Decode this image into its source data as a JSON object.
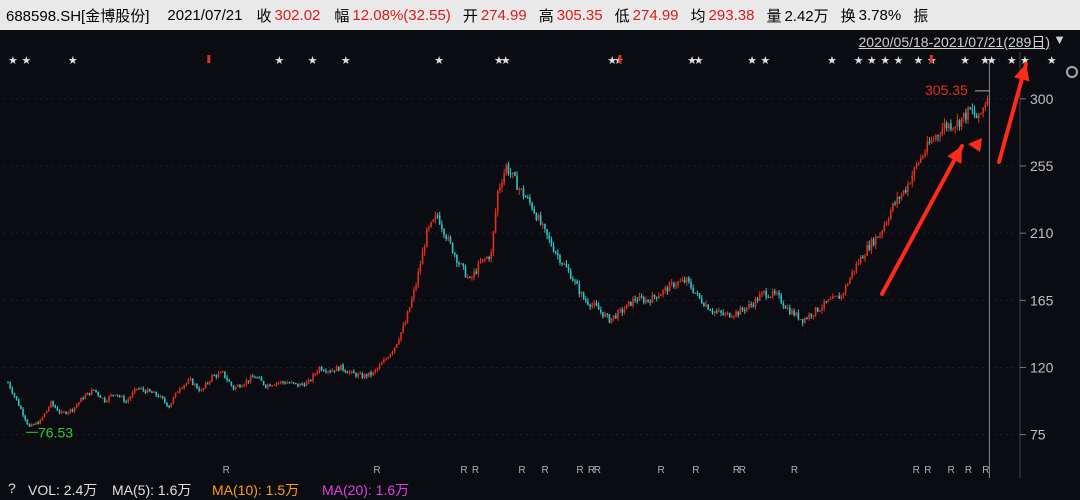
{
  "header": {
    "code": "688598.SH[金博股份]",
    "date": "2021/07/21",
    "close_label": "收",
    "close": "302.02",
    "change_label": "幅",
    "change": "12.08%(32.55)",
    "open_label": "开",
    "open": "274.99",
    "high_label": "高",
    "high": "305.35",
    "low_label": "低",
    "low": "274.99",
    "avg_label": "均",
    "avg": "293.38",
    "volume_label": "量",
    "volume": "2.42万",
    "turnover_label": "换",
    "turnover": "3.78%",
    "amplitude_label": "振"
  },
  "range": {
    "text": "2020/05/18-2021/07/21(289日)",
    "arrow": "▼"
  },
  "chart_data": {
    "type": "candlestick",
    "ylim": [
      60,
      318
    ],
    "yticks": [
      300,
      255,
      210,
      165,
      120,
      75
    ],
    "ytick_labels": [
      "300",
      "255",
      "210",
      "165",
      "120",
      "75"
    ],
    "annotations": {
      "high": "305.35",
      "low": "76.53"
    },
    "close_trend": [
      [
        0,
        110
      ],
      [
        5,
        95
      ],
      [
        10,
        80
      ],
      [
        15,
        84
      ],
      [
        20,
        96
      ],
      [
        25,
        89
      ],
      [
        30,
        92
      ],
      [
        35,
        100
      ],
      [
        40,
        105
      ],
      [
        45,
        98
      ],
      [
        50,
        103
      ],
      [
        55,
        97
      ],
      [
        60,
        106
      ],
      [
        65,
        104
      ],
      [
        70,
        101
      ],
      [
        75,
        94
      ],
      [
        80,
        107
      ],
      [
        85,
        111
      ],
      [
        90,
        104
      ],
      [
        95,
        114
      ],
      [
        100,
        116
      ],
      [
        105,
        106
      ],
      [
        110,
        110
      ],
      [
        115,
        114
      ],
      [
        120,
        108
      ],
      [
        125,
        110
      ],
      [
        130,
        110
      ],
      [
        135,
        108
      ],
      [
        140,
        110
      ],
      [
        145,
        120
      ],
      [
        150,
        118
      ],
      [
        155,
        120
      ],
      [
        160,
        116
      ],
      [
        165,
        114
      ],
      [
        170,
        116
      ],
      [
        175,
        124
      ],
      [
        180,
        134
      ],
      [
        185,
        150
      ],
      [
        190,
        176
      ],
      [
        195,
        210
      ],
      [
        200,
        222
      ],
      [
        205,
        205
      ],
      [
        210,
        190
      ],
      [
        215,
        178
      ],
      [
        220,
        190
      ],
      [
        225,
        196
      ],
      [
        228,
        238
      ],
      [
        232,
        255
      ],
      [
        238,
        240
      ],
      [
        244,
        228
      ],
      [
        250,
        210
      ],
      [
        256,
        195
      ],
      [
        262,
        182
      ],
      [
        268,
        166
      ],
      [
        274,
        160
      ],
      [
        280,
        152
      ],
      [
        286,
        158
      ],
      [
        292,
        166
      ],
      [
        298,
        165
      ],
      [
        304,
        170
      ],
      [
        310,
        176
      ],
      [
        316,
        178
      ],
      [
        322,
        166
      ],
      [
        328,
        158
      ],
      [
        334,
        155
      ],
      [
        340,
        157
      ],
      [
        346,
        162
      ],
      [
        352,
        170
      ],
      [
        358,
        168
      ],
      [
        364,
        158
      ],
      [
        370,
        152
      ],
      [
        376,
        158
      ],
      [
        382,
        164
      ],
      [
        388,
        168
      ],
      [
        394,
        186
      ],
      [
        400,
        200
      ],
      [
        406,
        210
      ],
      [
        412,
        228
      ],
      [
        418,
        240
      ],
      [
        424,
        258
      ],
      [
        430,
        272
      ],
      [
        436,
        282
      ],
      [
        442,
        284
      ],
      [
        448,
        292
      ],
      [
        452,
        286
      ],
      [
        456,
        302
      ]
    ],
    "star_marks": [
      0,
      4,
      18,
      80,
      90,
      100,
      128,
      146,
      148,
      180,
      182,
      204,
      206,
      222,
      226,
      246,
      254,
      258,
      262,
      266,
      272,
      276,
      286,
      292,
      294,
      300,
      304,
      312
    ],
    "r_marks": [
      74,
      126,
      156,
      160,
      176,
      184,
      196,
      200,
      202,
      224,
      236,
      250,
      252,
      270,
      312,
      316,
      324,
      330,
      336
    ],
    "red_flags": [
      32,
      98,
      148,
      186
    ]
  },
  "footer": {
    "help": "?",
    "vol": "VOL: 2.4万",
    "ma5": "MA(5): 1.6万",
    "ma10": "MA(10): 1.5万",
    "ma20": "MA(20): 1.6万"
  },
  "colors": {
    "up": "#e0301e",
    "down": "#2ec4c4",
    "ma5": "#ffffff",
    "ma10": "#ff9a1e",
    "ma20": "#e040e0",
    "low_label": "#3cc03c",
    "arrow": "#ff2a1a"
  }
}
